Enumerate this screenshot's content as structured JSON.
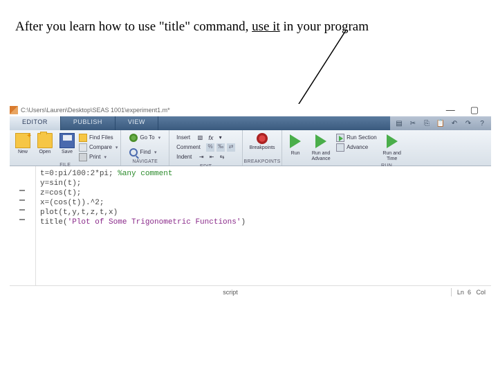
{
  "instruction": {
    "pre": "After you learn how to use \"title\" command, ",
    "underline": "use it",
    "post": " in your program"
  },
  "titlebar": {
    "path": "C:\\Users\\Lauren\\Desktop\\SEAS 1001\\experiment1.m*"
  },
  "tabs": {
    "editor": "EDITOR",
    "publish": "PUBLISH",
    "view": "VIEW"
  },
  "toolbar": {
    "new": "New",
    "open": "Open",
    "save": "Save",
    "findfiles": "Find Files",
    "compare": "Compare",
    "print": "Print",
    "goto": "Go To",
    "find": "Find",
    "insert": "Insert",
    "comment": "Comment",
    "indent": "Indent",
    "breakpoints": "Breakpoints",
    "run": "Run",
    "runadvance": "Run and\nAdvance",
    "runsection": "Run Section",
    "advance": "Advance",
    "runtime": "Run and\nTime"
  },
  "groups": {
    "file": "FILE",
    "navigate": "NAVIGATE",
    "edit": "EDIT",
    "breakpoints": "BREAKPOINTS",
    "run": "RUN"
  },
  "code": {
    "l1a": "t=0:pi/100:2*pi; ",
    "l1b": "%any comment",
    "l2": "y=sin(t);",
    "l3": "z=cos(t);",
    "l4": "x=(cos(t)).^2;",
    "l5": "plot(t,y,t,z,t,x)",
    "l6a": "title(",
    "l6b": "'Plot of Some Trigonometric Functions'",
    "l6c": ")"
  },
  "status": {
    "type": "script",
    "ln": "Ln",
    "lnval": "6",
    "col": "Col"
  }
}
